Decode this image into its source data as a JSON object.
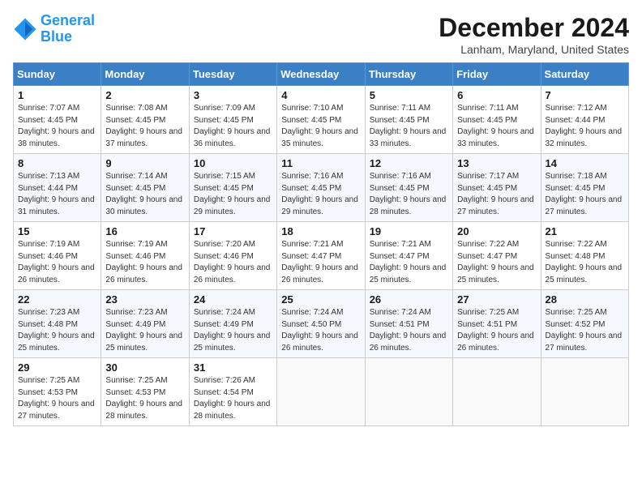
{
  "logo": {
    "line1": "General",
    "line2": "Blue"
  },
  "title": "December 2024",
  "location": "Lanham, Maryland, United States",
  "days_of_week": [
    "Sunday",
    "Monday",
    "Tuesday",
    "Wednesday",
    "Thursday",
    "Friday",
    "Saturday"
  ],
  "weeks": [
    [
      {
        "day": "1",
        "sunrise": "7:07 AM",
        "sunset": "4:45 PM",
        "daylight": "9 hours and 38 minutes."
      },
      {
        "day": "2",
        "sunrise": "7:08 AM",
        "sunset": "4:45 PM",
        "daylight": "9 hours and 37 minutes."
      },
      {
        "day": "3",
        "sunrise": "7:09 AM",
        "sunset": "4:45 PM",
        "daylight": "9 hours and 36 minutes."
      },
      {
        "day": "4",
        "sunrise": "7:10 AM",
        "sunset": "4:45 PM",
        "daylight": "9 hours and 35 minutes."
      },
      {
        "day": "5",
        "sunrise": "7:11 AM",
        "sunset": "4:45 PM",
        "daylight": "9 hours and 33 minutes."
      },
      {
        "day": "6",
        "sunrise": "7:11 AM",
        "sunset": "4:45 PM",
        "daylight": "9 hours and 33 minutes."
      },
      {
        "day": "7",
        "sunrise": "7:12 AM",
        "sunset": "4:44 PM",
        "daylight": "9 hours and 32 minutes."
      }
    ],
    [
      {
        "day": "8",
        "sunrise": "7:13 AM",
        "sunset": "4:44 PM",
        "daylight": "9 hours and 31 minutes."
      },
      {
        "day": "9",
        "sunrise": "7:14 AM",
        "sunset": "4:45 PM",
        "daylight": "9 hours and 30 minutes."
      },
      {
        "day": "10",
        "sunrise": "7:15 AM",
        "sunset": "4:45 PM",
        "daylight": "9 hours and 29 minutes."
      },
      {
        "day": "11",
        "sunrise": "7:16 AM",
        "sunset": "4:45 PM",
        "daylight": "9 hours and 29 minutes."
      },
      {
        "day": "12",
        "sunrise": "7:16 AM",
        "sunset": "4:45 PM",
        "daylight": "9 hours and 28 minutes."
      },
      {
        "day": "13",
        "sunrise": "7:17 AM",
        "sunset": "4:45 PM",
        "daylight": "9 hours and 27 minutes."
      },
      {
        "day": "14",
        "sunrise": "7:18 AM",
        "sunset": "4:45 PM",
        "daylight": "9 hours and 27 minutes."
      }
    ],
    [
      {
        "day": "15",
        "sunrise": "7:19 AM",
        "sunset": "4:46 PM",
        "daylight": "9 hours and 26 minutes."
      },
      {
        "day": "16",
        "sunrise": "7:19 AM",
        "sunset": "4:46 PM",
        "daylight": "9 hours and 26 minutes."
      },
      {
        "day": "17",
        "sunrise": "7:20 AM",
        "sunset": "4:46 PM",
        "daylight": "9 hours and 26 minutes."
      },
      {
        "day": "18",
        "sunrise": "7:21 AM",
        "sunset": "4:47 PM",
        "daylight": "9 hours and 26 minutes."
      },
      {
        "day": "19",
        "sunrise": "7:21 AM",
        "sunset": "4:47 PM",
        "daylight": "9 hours and 25 minutes."
      },
      {
        "day": "20",
        "sunrise": "7:22 AM",
        "sunset": "4:47 PM",
        "daylight": "9 hours and 25 minutes."
      },
      {
        "day": "21",
        "sunrise": "7:22 AM",
        "sunset": "4:48 PM",
        "daylight": "9 hours and 25 minutes."
      }
    ],
    [
      {
        "day": "22",
        "sunrise": "7:23 AM",
        "sunset": "4:48 PM",
        "daylight": "9 hours and 25 minutes."
      },
      {
        "day": "23",
        "sunrise": "7:23 AM",
        "sunset": "4:49 PM",
        "daylight": "9 hours and 25 minutes."
      },
      {
        "day": "24",
        "sunrise": "7:24 AM",
        "sunset": "4:49 PM",
        "daylight": "9 hours and 25 minutes."
      },
      {
        "day": "25",
        "sunrise": "7:24 AM",
        "sunset": "4:50 PM",
        "daylight": "9 hours and 26 minutes."
      },
      {
        "day": "26",
        "sunrise": "7:24 AM",
        "sunset": "4:51 PM",
        "daylight": "9 hours and 26 minutes."
      },
      {
        "day": "27",
        "sunrise": "7:25 AM",
        "sunset": "4:51 PM",
        "daylight": "9 hours and 26 minutes."
      },
      {
        "day": "28",
        "sunrise": "7:25 AM",
        "sunset": "4:52 PM",
        "daylight": "9 hours and 27 minutes."
      }
    ],
    [
      {
        "day": "29",
        "sunrise": "7:25 AM",
        "sunset": "4:53 PM",
        "daylight": "9 hours and 27 minutes."
      },
      {
        "day": "30",
        "sunrise": "7:25 AM",
        "sunset": "4:53 PM",
        "daylight": "9 hours and 28 minutes."
      },
      {
        "day": "31",
        "sunrise": "7:26 AM",
        "sunset": "4:54 PM",
        "daylight": "9 hours and 28 minutes."
      },
      null,
      null,
      null,
      null
    ]
  ]
}
